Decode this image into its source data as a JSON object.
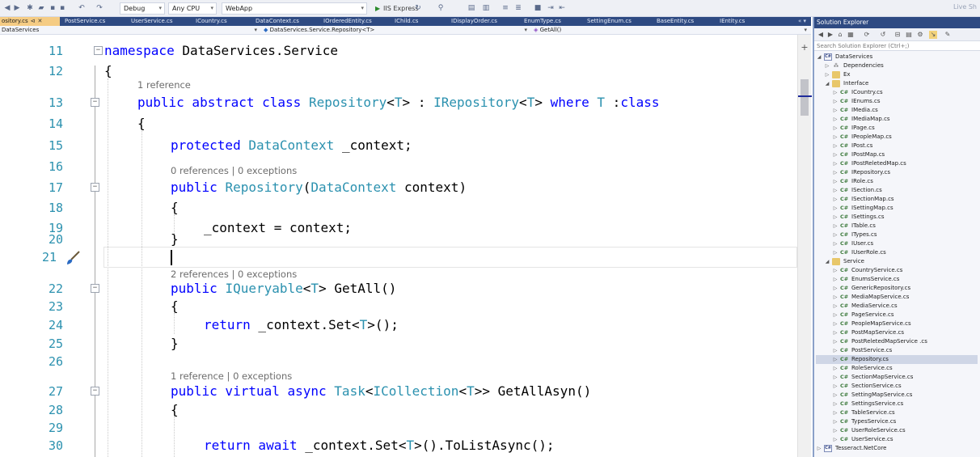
{
  "toolbar": {
    "config": "Debug",
    "platform": "Any CPU",
    "project": "WebApp",
    "run_target": "IIS Express",
    "live_share": "Live Sh"
  },
  "tabs": [
    {
      "label": "ository.cs",
      "active": true
    },
    {
      "label": "PostService.cs"
    },
    {
      "label": "UserService.cs"
    },
    {
      "label": "ICountry.cs"
    },
    {
      "label": "DataContext.cs"
    },
    {
      "label": "IOrderedEntity.cs"
    },
    {
      "label": "IChild.cs"
    },
    {
      "label": "IDisplayOrder.cs"
    },
    {
      "label": "EnumType.cs"
    },
    {
      "label": "SettingEnum.cs"
    },
    {
      "label": "BaseEntity.cs"
    },
    {
      "label": "IEntity.cs"
    }
  ],
  "navbar": {
    "project": "DataServices",
    "class": "DataServices.Service.Repository<T>",
    "member": "GetAll()"
  },
  "editor": {
    "lines": [
      {
        "n": "11",
        "code": "namespace DataServices.Service"
      },
      {
        "n": "12",
        "code": "{"
      },
      {
        "lens": "1 reference"
      },
      {
        "n": "13",
        "code": "public abstract class Repository<T> : IRepository<T> where T :class"
      },
      {
        "n": "14",
        "code": "{"
      },
      {
        "n": "15",
        "code": "protected DataContext _context;"
      },
      {
        "n": "16",
        "code": ""
      },
      {
        "lens": "0 references | 0 exceptions"
      },
      {
        "n": "17",
        "code": "public Repository(DataContext context)"
      },
      {
        "n": "18",
        "code": "{"
      },
      {
        "n": "19",
        "code": "_context = context;"
      },
      {
        "n": "20",
        "code": "}"
      },
      {
        "n": "21",
        "code": ""
      },
      {
        "lens": "2 references | 0 exceptions"
      },
      {
        "n": "22",
        "code": "public IQueryable<T> GetAll()"
      },
      {
        "n": "23",
        "code": "{"
      },
      {
        "n": "24",
        "code": "return _context.Set<T>();"
      },
      {
        "n": "25",
        "code": "}"
      },
      {
        "n": "26",
        "code": ""
      },
      {
        "lens": "1 reference | 0 exceptions"
      },
      {
        "n": "27",
        "code": "public virtual async Task<ICollection<T>> GetAllAsyn()"
      },
      {
        "n": "28",
        "code": "{"
      },
      {
        "n": "29",
        "code": ""
      },
      {
        "n": "30",
        "code": "return await _context.Set<T>().ToListAsync();"
      }
    ]
  },
  "solution_explorer": {
    "title": "Solution Explorer",
    "search_placeholder": "Search Solution Explorer (Ctrl+;)",
    "tree": [
      {
        "label": "DataServices",
        "kind": "project",
        "arrow": "◢",
        "depth": 0
      },
      {
        "label": "Dependencies",
        "kind": "dep",
        "arrow": "▷",
        "depth": 1
      },
      {
        "label": "Ex",
        "kind": "folder",
        "arrow": "▷",
        "depth": 1
      },
      {
        "label": "Interface",
        "kind": "folder",
        "arrow": "◢",
        "depth": 1
      },
      {
        "label": "ICountry.cs",
        "kind": "cs",
        "depth": 2
      },
      {
        "label": "IEnums.cs",
        "kind": "cs",
        "depth": 2
      },
      {
        "label": "IMedia.cs",
        "kind": "cs",
        "depth": 2
      },
      {
        "label": "IMediaMap.cs",
        "kind": "cs",
        "depth": 2
      },
      {
        "label": "IPage.cs",
        "kind": "cs",
        "depth": 2
      },
      {
        "label": "IPeopleMap.cs",
        "kind": "cs",
        "depth": 2
      },
      {
        "label": "IPost.cs",
        "kind": "cs",
        "depth": 2
      },
      {
        "label": "IPostMap.cs",
        "kind": "cs",
        "depth": 2
      },
      {
        "label": "IPostReletedMap.cs",
        "kind": "cs",
        "depth": 2
      },
      {
        "label": "IRepository.cs",
        "kind": "cs",
        "depth": 2
      },
      {
        "label": "IRole.cs",
        "kind": "cs",
        "depth": 2
      },
      {
        "label": "ISection.cs",
        "kind": "cs",
        "depth": 2
      },
      {
        "label": "ISectionMap.cs",
        "kind": "cs",
        "depth": 2
      },
      {
        "label": "ISettingMap.cs",
        "kind": "cs",
        "depth": 2
      },
      {
        "label": "ISettings.cs",
        "kind": "cs",
        "depth": 2
      },
      {
        "label": "ITable.cs",
        "kind": "cs",
        "depth": 2
      },
      {
        "label": "ITypes.cs",
        "kind": "cs",
        "depth": 2
      },
      {
        "label": "IUser.cs",
        "kind": "cs",
        "depth": 2
      },
      {
        "label": "IUserRole.cs",
        "kind": "cs",
        "depth": 2
      },
      {
        "label": "Service",
        "kind": "folder",
        "arrow": "◢",
        "depth": 1
      },
      {
        "label": "CountryService.cs",
        "kind": "cs",
        "depth": 2
      },
      {
        "label": "EnumsService.cs",
        "kind": "cs",
        "depth": 2
      },
      {
        "label": "GenericRepository.cs",
        "kind": "cs",
        "depth": 2
      },
      {
        "label": "MediaMapService.cs",
        "kind": "cs",
        "depth": 2
      },
      {
        "label": "MediaService.cs",
        "kind": "cs",
        "depth": 2
      },
      {
        "label": "PageService.cs",
        "kind": "cs",
        "depth": 2
      },
      {
        "label": "PeopleMapService.cs",
        "kind": "cs",
        "depth": 2
      },
      {
        "label": "PostMapService.cs",
        "kind": "cs",
        "depth": 2
      },
      {
        "label": "PostReletedMapService .cs",
        "kind": "cs",
        "depth": 2
      },
      {
        "label": "PostService.cs",
        "kind": "cs",
        "depth": 2
      },
      {
        "label": "Repository.cs",
        "kind": "cs",
        "depth": 2,
        "selected": true
      },
      {
        "label": "RoleService.cs",
        "kind": "cs",
        "depth": 2
      },
      {
        "label": "SectionMapService.cs",
        "kind": "cs",
        "depth": 2
      },
      {
        "label": "SectionService.cs",
        "kind": "cs",
        "depth": 2
      },
      {
        "label": "SettingMapService.cs",
        "kind": "cs",
        "depth": 2
      },
      {
        "label": "SettingsService.cs",
        "kind": "cs",
        "depth": 2
      },
      {
        "label": "TableService.cs",
        "kind": "cs",
        "depth": 2
      },
      {
        "label": "TypesService.cs",
        "kind": "cs",
        "depth": 2
      },
      {
        "label": "UserRoleService.cs",
        "kind": "cs",
        "depth": 2
      },
      {
        "label": "UserService.cs",
        "kind": "cs",
        "depth": 2
      },
      {
        "label": "Tesseract.NetCore",
        "kind": "project",
        "arrow": "▷",
        "depth": 0
      }
    ]
  },
  "colors": {
    "keyword": "#0000ff",
    "type": "#2b91af",
    "line_number": "#2b91af",
    "codelens": "#6d6d6d",
    "tab_bar": "#2e4a82",
    "active_tab": "#f5cc84"
  }
}
